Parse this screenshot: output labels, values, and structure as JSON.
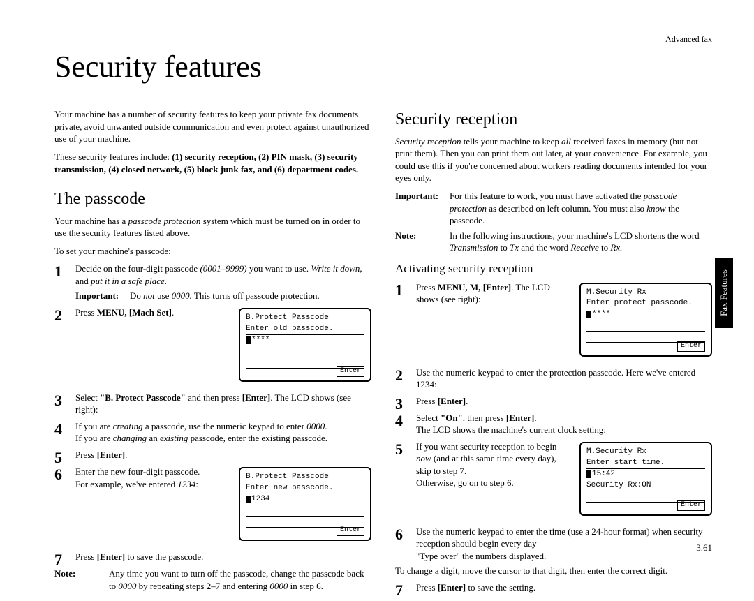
{
  "header": {
    "section": "Advanced fax"
  },
  "title": "Security features",
  "intro": {
    "p1": "Your machine has a number of security features to keep your private fax documents private, avoid unwanted outside communication and even protect against unauthorized use of your machine.",
    "p2_pre": "These security features include: ",
    "p2_items": "(1) security reception, (2) PIN mask, (3) security transmission, (4) closed network, (5) block junk fax, and (6) department codes."
  },
  "passcode": {
    "heading": "The passcode",
    "p1_a": "Your machine has a ",
    "p1_b": "passcode protection",
    "p1_c": " system which must be turned on in order to use the security features listed above.",
    "p2": "To set your machine's passcode:",
    "steps": {
      "s1_a": "Decide on the four-digit passcode ",
      "s1_b": "(0001–9999)",
      "s1_c": " you want to use. ",
      "s1_d": "Write it down",
      "s1_e": ", and ",
      "s1_f": "put it in a safe place.",
      "s1_imp_a": "Do ",
      "s1_imp_b": "not",
      "s1_imp_c": " use ",
      "s1_imp_d": "0000.",
      "s1_imp_e": " This turns off passcode protection.",
      "s2_a": "Press ",
      "s2_b": "MENU",
      "s2_c": ", ",
      "s2_d": "[Mach Set]",
      "s2_e": ".",
      "s3_a": "Select ",
      "s3_b": "\"B. Protect Passcode\"",
      "s3_c": " and then press ",
      "s3_d": "[Enter]",
      "s3_e": ". The ",
      "s3_f": "LCD",
      "s3_g": " shows (see right):",
      "s4_a": "If you are ",
      "s4_b": "creating",
      "s4_c": " a passcode, use the numeric keypad to enter ",
      "s4_d": "0000",
      "s4_e": ".",
      "s4_2a": "If you are ",
      "s4_2b": "changing",
      "s4_2c": " an ",
      "s4_2d": "existing",
      "s4_2e": " passcode, enter the existing passcode.",
      "s5_a": "Press ",
      "s5_b": "[Enter]",
      "s5_c": ".",
      "s6_a": "Enter the new four-digit passcode.",
      "s6_b": "For example, we've entered ",
      "s6_c": "1234",
      "s6_d": ":",
      "s7_a": "Press ",
      "s7_b": "[Enter]",
      "s7_c": " to save the passcode."
    },
    "note_a": "Any time you want to turn off the passcode, change the passcode back to ",
    "note_b": "0000",
    "note_c": " by repeating steps 2–7 and entering ",
    "note_d": "0000",
    "note_e": " in step 6.",
    "lcd1": {
      "title": "B.Protect Passcode",
      "line1": "Enter old passcode.",
      "line2": "****",
      "enter": "Enter"
    },
    "lcd2": {
      "title": "B.Protect Passcode",
      "line1": "Enter new passcode.",
      "line2": "1234",
      "enter": "Enter"
    }
  },
  "reception": {
    "heading": "Security reception",
    "p1_a": "Security reception",
    "p1_b": " tells your machine to keep ",
    "p1_c": "all",
    "p1_d": " received faxes in memory (but not print them). Then you can print them out later, at your convenience. For example, you could use this if you're concerned about workers reading documents intended for your eyes only.",
    "imp_a": "For this feature to work, you must have activated the ",
    "imp_b": "passcode protection",
    "imp_c": " as described on left column. You must also ",
    "imp_d": "know",
    "imp_e": " the passcode.",
    "note_a": "In the following instructions, your machine's ",
    "note_b": "LCD",
    "note_c": " shortens the word ",
    "note_d": "Transmission",
    "note_e": " to ",
    "note_f": "Tx",
    "note_g": " and the word ",
    "note_h": "Receive",
    "note_i": " to ",
    "note_j": "Rx.",
    "sub": "Activating security reception",
    "steps": {
      "s1_a": "Press ",
      "s1_b": "MENU",
      "s1_c": ", ",
      "s1_d": "M",
      "s1_e": ", ",
      "s1_f": "[Enter]",
      "s1_g": ". The ",
      "s1_h": "LCD",
      "s1_i": " shows (see right):",
      "s2": "Use the numeric keypad to enter the protection passcode. Here we've entered 1234:",
      "s3_a": "Press ",
      "s3_b": "[Enter]",
      "s3_c": ".",
      "s4_a": "Select ",
      "s4_b": "\"On\"",
      "s4_c": ", then press ",
      "s4_d": "[Enter]",
      "s4_e": ".",
      "s4_2a": "The ",
      "s4_2b": "LCD",
      "s4_2c": " shows the machine's current clock setting:",
      "s5_a": "If you want security reception to begin ",
      "s5_b": "now",
      "s5_c": " (and at this same time every day), skip to step 7.",
      "s5_2": "Otherwise, go on to step 6.",
      "s6_a": "Use the numeric keypad to enter the time (use a 24-hour format) when security reception should begin every day",
      "s6_b": "\"Type over\" the numbers displayed.",
      "s6_c": "To change a digit, move the cursor to that digit, then enter the correct digit.",
      "s7_a": "Press ",
      "s7_b": "[Enter]",
      "s7_c": " to save the setting."
    },
    "lcd1": {
      "title": "M.Security Rx",
      "line1": "Enter protect passcode.",
      "line2": "****",
      "enter": "Enter"
    },
    "lcd2": {
      "title": "M.Security Rx",
      "line1": "Enter start time.",
      "line2": "15:42",
      "line3": "Security Rx:ON",
      "enter": "Enter"
    }
  },
  "sideTab": "Fax Features",
  "pageNumber": "3.61"
}
